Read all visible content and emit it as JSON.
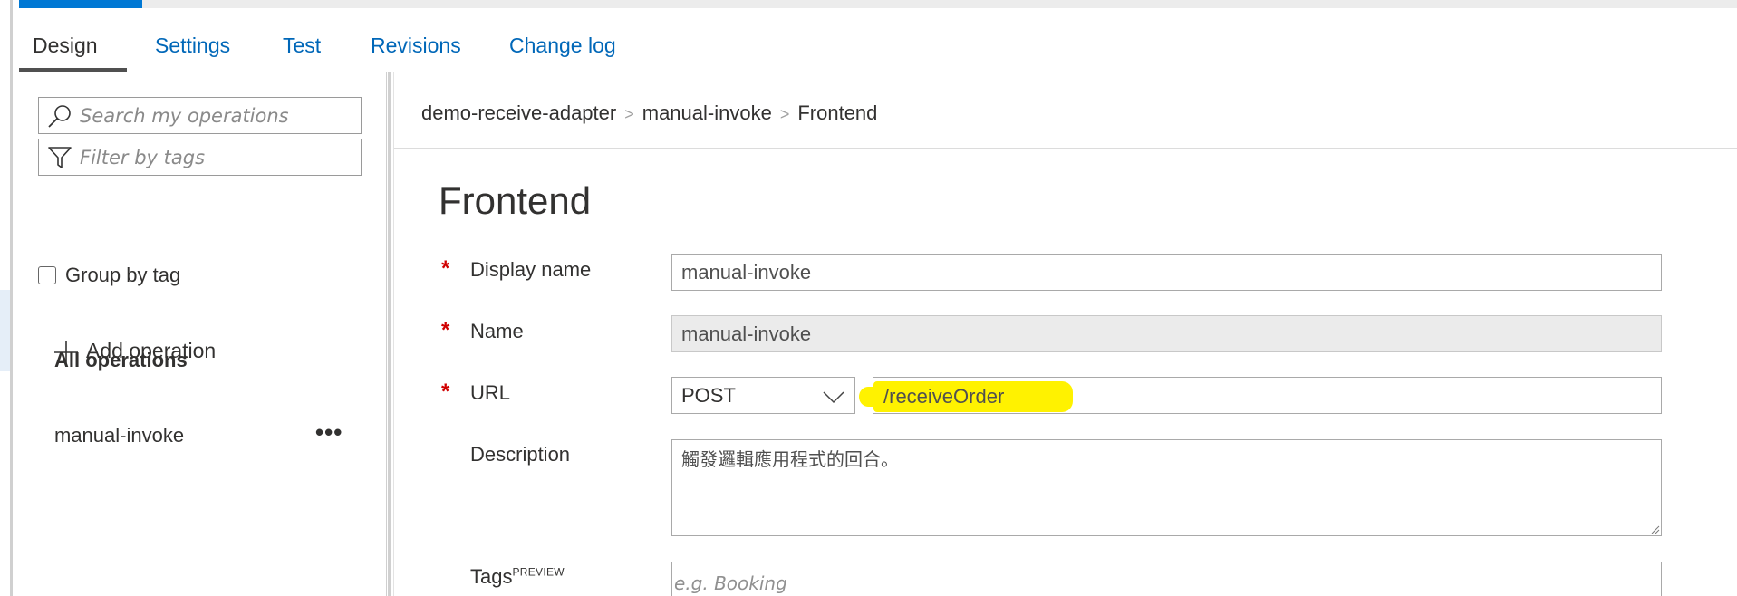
{
  "tabs": [
    {
      "label": "Design",
      "active": true
    },
    {
      "label": "Settings"
    },
    {
      "label": "Test"
    },
    {
      "label": "Revisions"
    },
    {
      "label": "Change log"
    }
  ],
  "sidebar": {
    "search_placeholder": "Search my operations",
    "filter_placeholder": "Filter by tags",
    "group_by_tag_label": "Group by tag",
    "group_by_tag_checked": false,
    "add_operation_label": "Add operation",
    "all_operations_label": "All operations",
    "operations": [
      {
        "label": "manual-invoke",
        "more": "•••"
      }
    ]
  },
  "breadcrumb": {
    "items": [
      "demo-receive-adapter",
      "manual-invoke",
      "Frontend"
    ],
    "separator": ">"
  },
  "form": {
    "title": "Frontend",
    "display_name": {
      "label": "Display name",
      "required": "*",
      "value": "manual-invoke"
    },
    "name": {
      "label": "Name",
      "required": "*",
      "value": "manual-invoke"
    },
    "url": {
      "label": "URL",
      "required": "*",
      "method": "POST",
      "template": "/receiveOrder"
    },
    "description": {
      "label": "Description",
      "value": "觸發邏輯應用程式的回合。"
    },
    "tags": {
      "label": "Tags",
      "badge": "PREVIEW",
      "placeholder": "e.g. Booking"
    }
  },
  "colors": {
    "accent": "#0078d4",
    "link": "#0067b8",
    "required": "#d00000",
    "highlight": "#fff200"
  },
  "icons": [
    "search-icon",
    "filter-icon",
    "plus-icon",
    "more-icon",
    "chevron-down-icon"
  ]
}
